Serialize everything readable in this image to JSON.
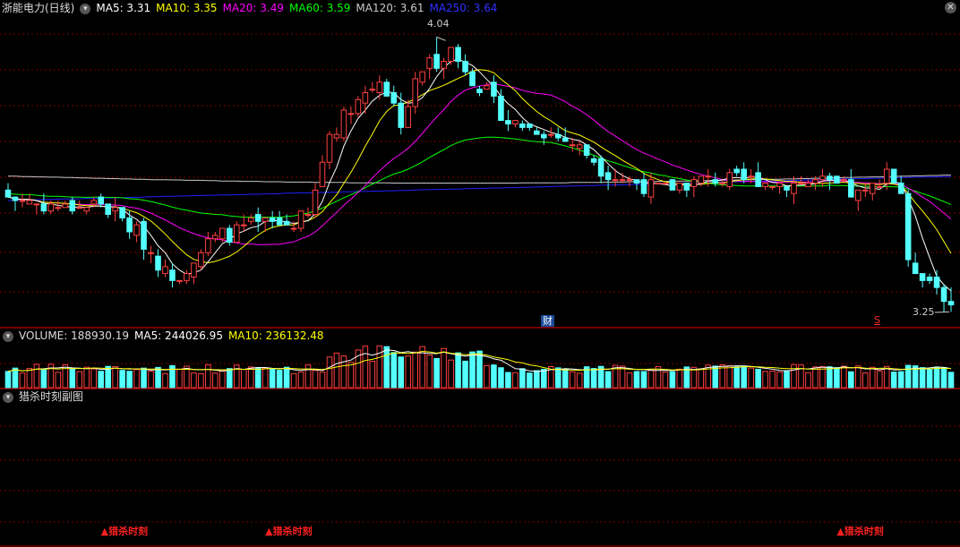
{
  "price_header": {
    "stock": "浙能电力(日线)",
    "ma5": "MA5: 3.31",
    "ma10": "MA10: 3.35",
    "ma20": "MA20: 3.49",
    "ma60": "MA60: 3.59",
    "ma120": "MA120: 3.61",
    "ma250": "MA250: 3.64"
  },
  "volume_header": {
    "volume": "VOLUME: 188930.19",
    "ma5": "MA5: 244026.95",
    "ma10": "MA10: 236132.48"
  },
  "sub_header": {
    "title": "猎杀时刻副图"
  },
  "annotations": {
    "high_label": "4.04",
    "low_label": "3.25",
    "event_cai": "财",
    "event_s": "S"
  },
  "signals": [
    {
      "label": "▲猎杀时刻",
      "bar": 14
    },
    {
      "label": "▲猎杀时刻",
      "bar": 37
    },
    {
      "label": "▲猎杀时刻",
      "bar": 117
    }
  ],
  "colors": {
    "up": "#ff4040",
    "down": "#54ffff",
    "ma5": "#ffffff",
    "ma10": "#ffff00",
    "ma20": "#ff00ff",
    "ma60": "#00ff00",
    "ma120": "#c8c8c8",
    "ma250": "#2020ff",
    "grid": "#7a0000"
  },
  "chart_data": {
    "type": "candlestick",
    "price_range": [
      3.22,
      4.1
    ],
    "candles_ohlc": [],
    "volume": [],
    "volume_ma5": [],
    "volume_ma10": [],
    "ma5": [],
    "ma10": [],
    "ma20": [],
    "ma60": [],
    "ma120": [],
    "ma250": []
  }
}
